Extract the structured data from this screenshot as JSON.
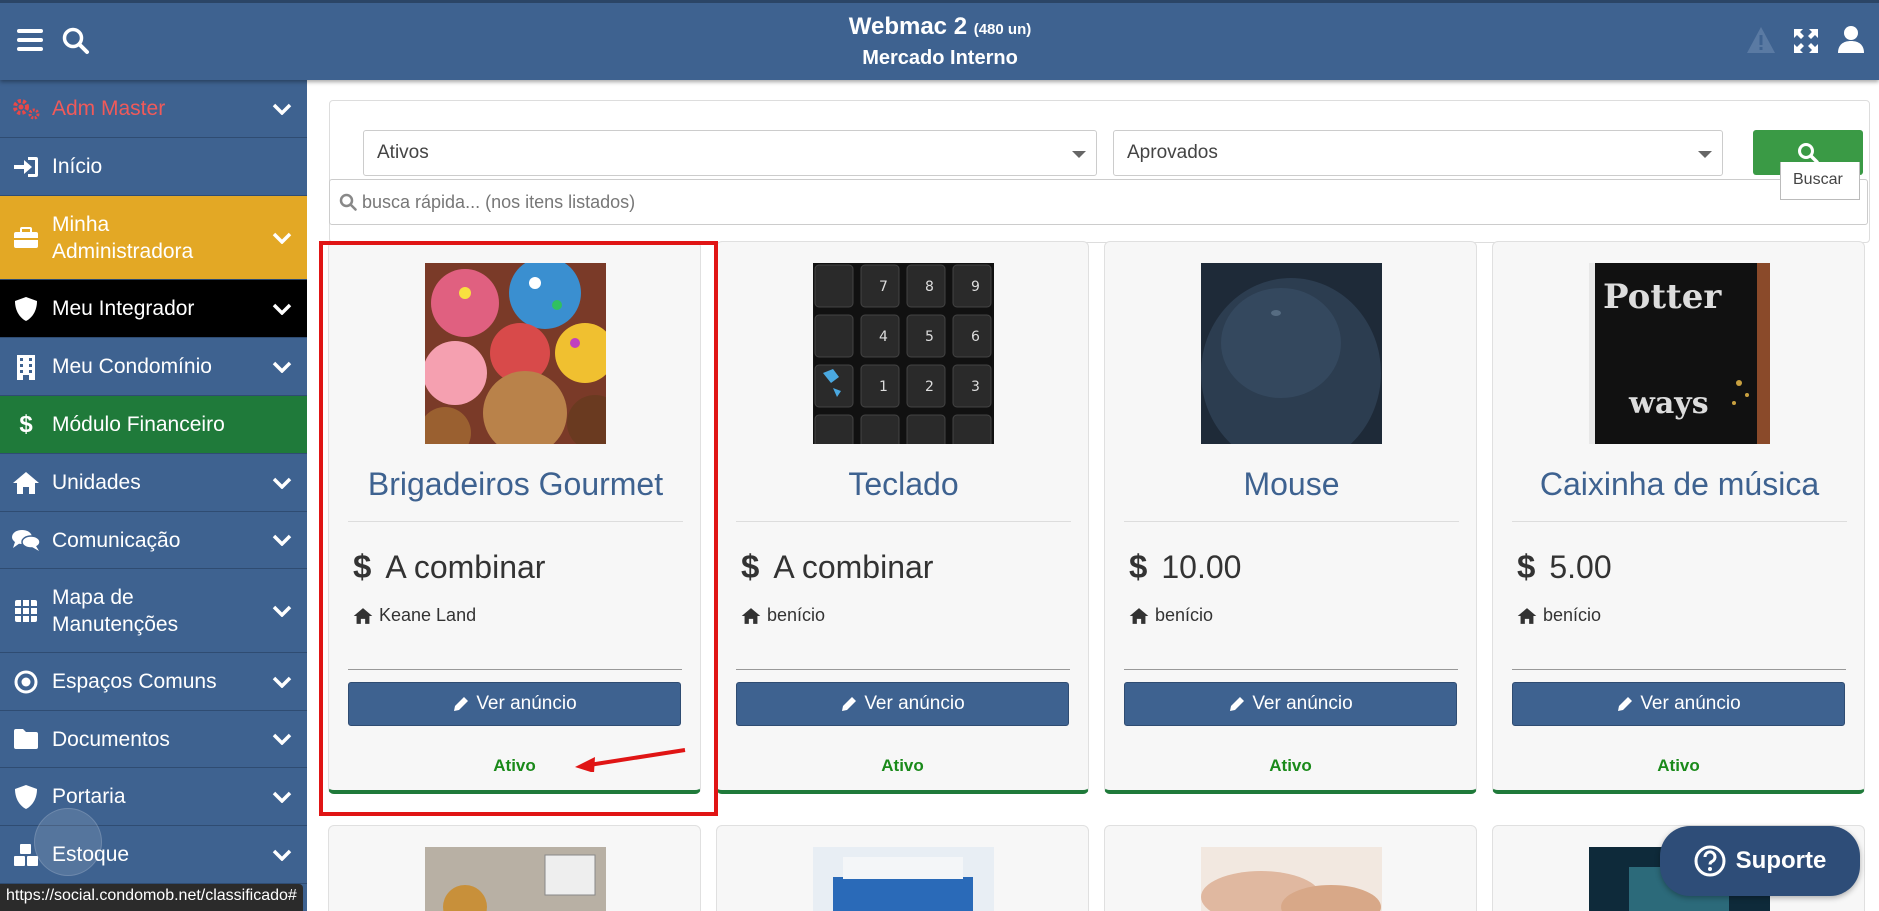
{
  "header": {
    "title": "Webmac 2",
    "count": "(480 un)",
    "subtitle": "Mercado Interno"
  },
  "sidebar": {
    "items": [
      {
        "label": "Adm Master",
        "icon": "gears-icon",
        "style": "red",
        "chevron": true
      },
      {
        "label": "Início",
        "icon": "sign-in-icon",
        "style": "normal",
        "chevron": false
      },
      {
        "label": "Minha Administradora",
        "icon": "briefcase-icon",
        "style": "yellow",
        "chevron": true
      },
      {
        "label": "Meu Integrador",
        "icon": "shield-icon",
        "style": "black",
        "chevron": true
      },
      {
        "label": "Meu Condomínio",
        "icon": "building-icon",
        "style": "normal",
        "chevron": true
      },
      {
        "label": "Módulo Financeiro",
        "icon": "dollar-icon",
        "style": "green",
        "chevron": false
      },
      {
        "label": "Unidades",
        "icon": "home-icon",
        "style": "normal",
        "chevron": true
      },
      {
        "label": "Comunicação",
        "icon": "comments-icon",
        "style": "normal",
        "chevron": true
      },
      {
        "label": "Mapa de Manutenções",
        "icon": "grid-icon",
        "style": "normal",
        "chevron": true
      },
      {
        "label": "Espaços Comuns",
        "icon": "target-icon",
        "style": "normal",
        "chevron": true
      },
      {
        "label": "Documentos",
        "icon": "folder-icon",
        "style": "normal",
        "chevron": true
      },
      {
        "label": "Portaria",
        "icon": "shield-icon",
        "style": "normal",
        "chevron": true
      },
      {
        "label": "Estoque",
        "icon": "cubes-icon",
        "style": "normal",
        "chevron": true
      }
    ]
  },
  "filters": {
    "status_select": "Ativos",
    "approval_select": "Aprovados",
    "search_tooltip": "Buscar",
    "quick_search_placeholder": "busca rápida... (nos itens listados)"
  },
  "cards": [
    {
      "name": "Brigadeiros Gourmet",
      "price": "A combinar",
      "owner": "Keane Land",
      "button": "Ver anúncio",
      "status": "Ativo"
    },
    {
      "name": "Teclado",
      "price": "A combinar",
      "owner": "benício",
      "button": "Ver anúncio",
      "status": "Ativo"
    },
    {
      "name": "Mouse",
      "price": "10.00",
      "owner": "benício",
      "button": "Ver anúncio",
      "status": "Ativo"
    },
    {
      "name": "Caixinha de música",
      "price": "5.00",
      "owner": "benício",
      "button": "Ver anúncio",
      "status": "Ativo"
    }
  ],
  "status_bar_url": "https://social.condomob.net/classificado#",
  "support_button": "Suporte",
  "colors": {
    "primary": "#3e6290",
    "success": "#3a9a45",
    "warning": "#e3a825",
    "active_text": "#1a8a1a",
    "highlight": "#e01515"
  }
}
